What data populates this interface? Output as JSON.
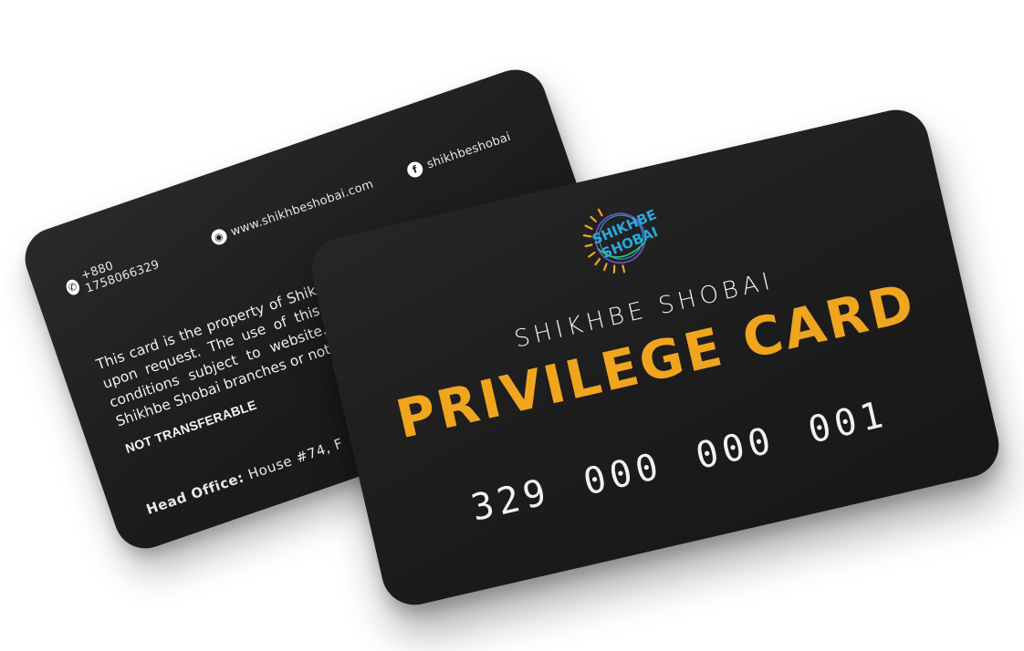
{
  "back_card": {
    "contacts": [
      {
        "icon": "phone-icon",
        "icon_glyph": "✆",
        "text": "+880 1758066329"
      },
      {
        "icon": "globe-icon",
        "icon_glyph": "◉",
        "text": "www.shikhbeshobai.com"
      },
      {
        "icon": "facebook-icon",
        "icon_glyph": "f",
        "text": "shikhbeshobai"
      }
    ],
    "body_text": "This card is the property of Shikhbe Shobai and must be returned upon request. The use of this card is governed by terms and conditions subject to website. If found, please return to any Shikhbe Shobai branches or notify Shikhbe Shobai.",
    "not_transferable": "NOT TRANSFERABLE",
    "head_office_label": "Head Office:",
    "head_office_value": "House #74, F"
  },
  "front_card": {
    "logo_text_line1": "SHIKHBE",
    "logo_text_line2": "SHOBAI",
    "brand_line": "SHIKHBE SHOBAI",
    "title": "PRIVILEGE CARD",
    "card_number": "329 000 000 001"
  },
  "colors": {
    "card_background": "#1d1d1d",
    "title_accent": "#f0a51e",
    "logo_blue": "#2aa8e0",
    "text_light": "#f0f0f0"
  }
}
